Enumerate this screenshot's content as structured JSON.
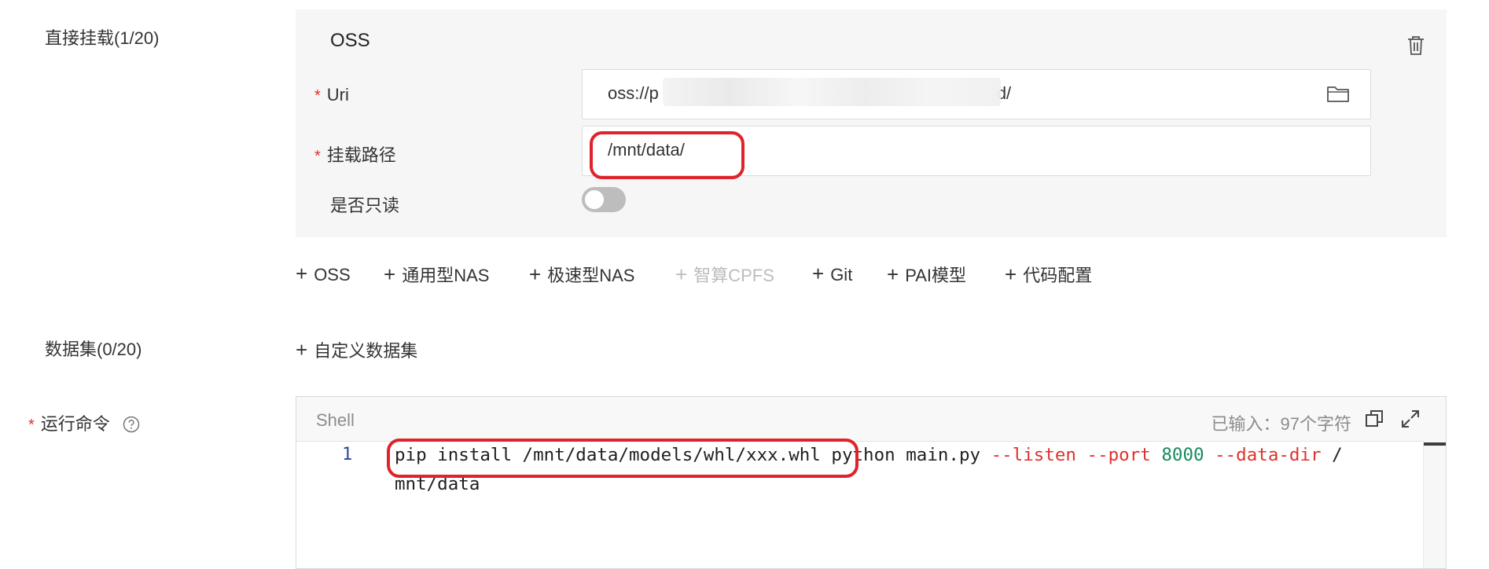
{
  "direct_mount": {
    "label": "直接挂载(1/20)",
    "oss": {
      "title": "OSS",
      "uri_label": "Uri",
      "uri_value_start": "oss://p",
      "uri_value_end": "d/",
      "mount_path_label": "挂载路径",
      "mount_path_value": "/mnt/data/",
      "readonly_label": "是否只读",
      "readonly_checked": false
    },
    "add_buttons": [
      {
        "label": "OSS",
        "disabled": false
      },
      {
        "label": "通用型NAS",
        "disabled": false
      },
      {
        "label": "极速型NAS",
        "disabled": false
      },
      {
        "label": "智算CPFS",
        "disabled": true
      },
      {
        "label": "Git",
        "disabled": false
      },
      {
        "label": "PAI模型",
        "disabled": false
      },
      {
        "label": "代码配置",
        "disabled": false
      }
    ],
    "plus": "+"
  },
  "dataset": {
    "label": "数据集(0/20)",
    "add_label": "自定义数据集"
  },
  "run_command": {
    "label": "运行命令",
    "required_mark": "*",
    "editor_lang": "Shell",
    "char_count": "已输入：97个字符",
    "line_number": "1",
    "code_tokens": {
      "highlighted": "pip install /mnt/data/models/whl/xxx.whl",
      "cmd": "python main.py",
      "flag_listen": "--listen",
      "flag_port": "--port",
      "port": "8000",
      "flag_data_dir": "--data-dir",
      "slash": "/",
      "line2": "mnt/data"
    }
  },
  "colors": {
    "required": "#e0312b",
    "highlight": "#e0222a",
    "flag": "#e0312b",
    "number": "#178a5a"
  },
  "icons": [
    "trash-icon",
    "folder-icon",
    "help-icon",
    "copy-icon",
    "expand-icon"
  ]
}
